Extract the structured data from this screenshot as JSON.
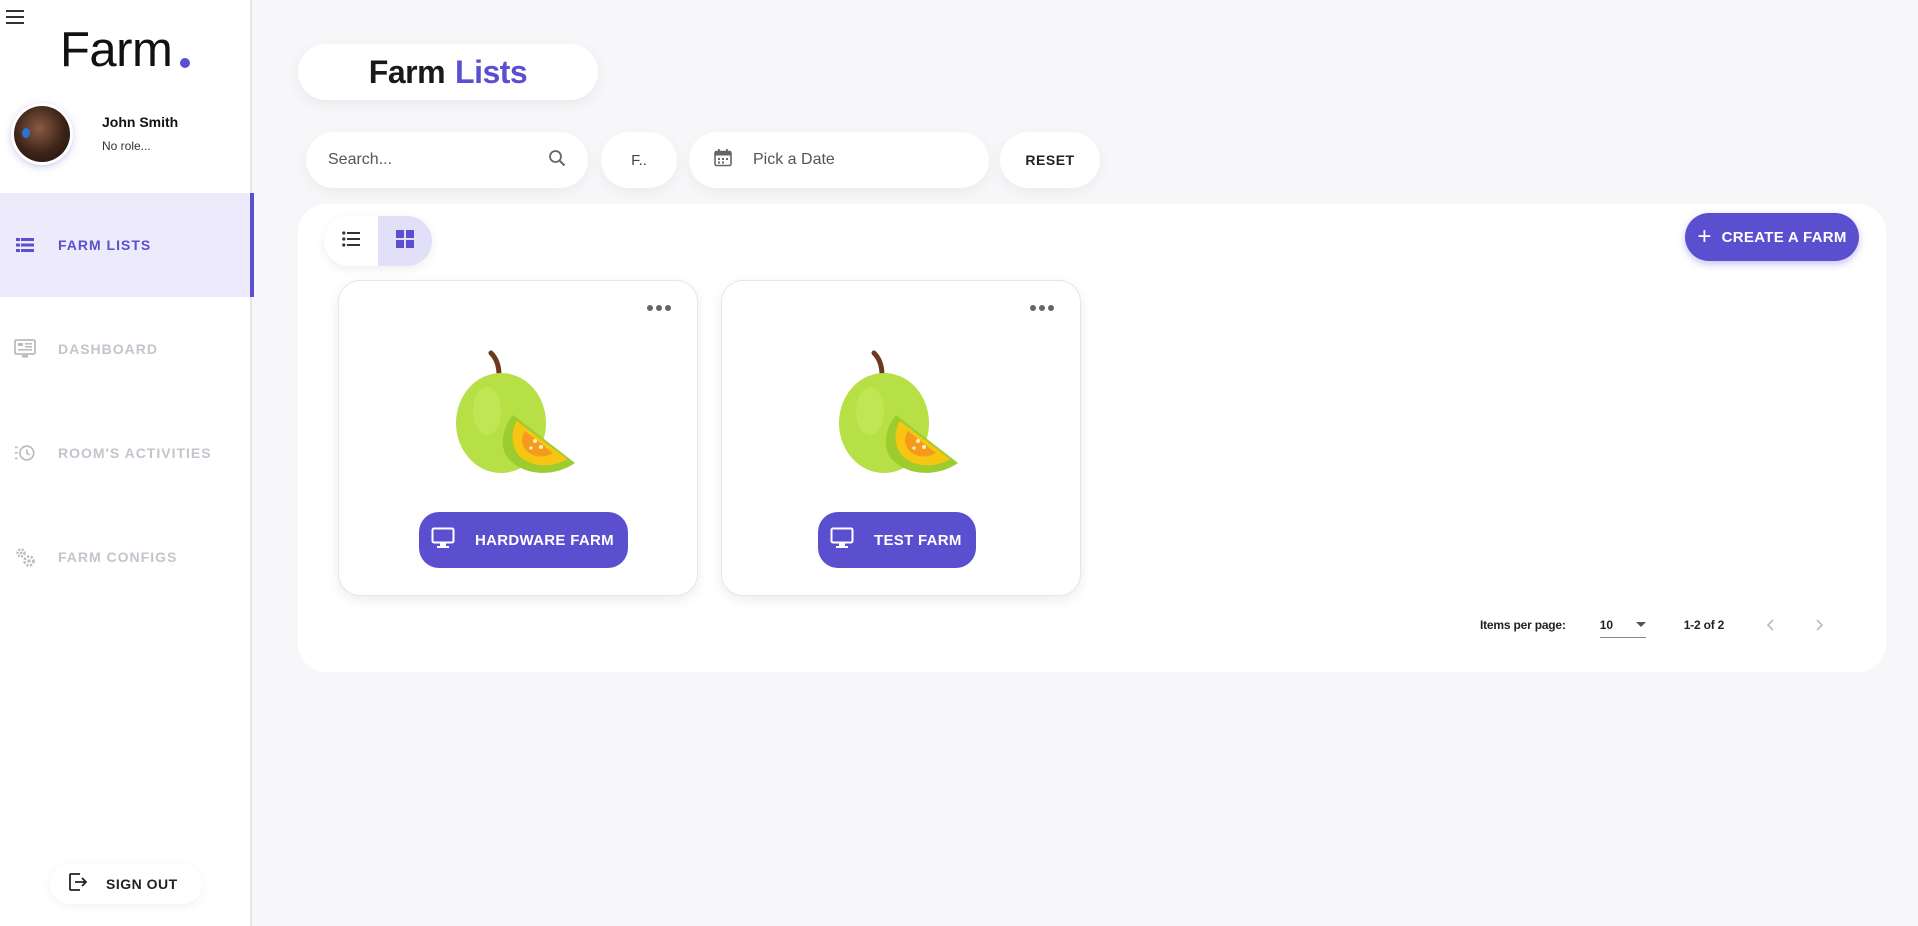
{
  "sidebar": {
    "logo": "Farm",
    "user": {
      "name": "John Smith",
      "role": "No role..."
    },
    "items": [
      {
        "label": "FARM LISTS",
        "icon": "list-icon",
        "active": true
      },
      {
        "label": "DASHBOARD",
        "icon": "dashboard-icon",
        "active": false
      },
      {
        "label": "ROOM'S ACTIVITIES",
        "icon": "history-icon",
        "active": false
      },
      {
        "label": "FARM CONFIGS",
        "icon": "gears-icon",
        "active": false
      }
    ],
    "signout_label": "SIGN OUT"
  },
  "header": {
    "title_a": "Farm",
    "title_b": "Lists"
  },
  "filters": {
    "search_placeholder": "Search...",
    "search_value": "",
    "filter_label": "F..",
    "date_placeholder": "Pick a Date",
    "reset_label": "RESET"
  },
  "toolbar": {
    "create_label": "CREATE A FARM"
  },
  "farms": [
    {
      "name": "HARDWARE FARM",
      "icon": "monitor-icon",
      "image": "guava-icon"
    },
    {
      "name": "TEST FARM",
      "icon": "monitor-icon",
      "image": "guava-icon"
    }
  ],
  "pagination": {
    "items_per_page_label": "Items per page:",
    "items_per_page_value": "10",
    "range": "1-2 of 2"
  },
  "colors": {
    "accent": "#5a4fcf",
    "background": "#f7f7fa"
  }
}
